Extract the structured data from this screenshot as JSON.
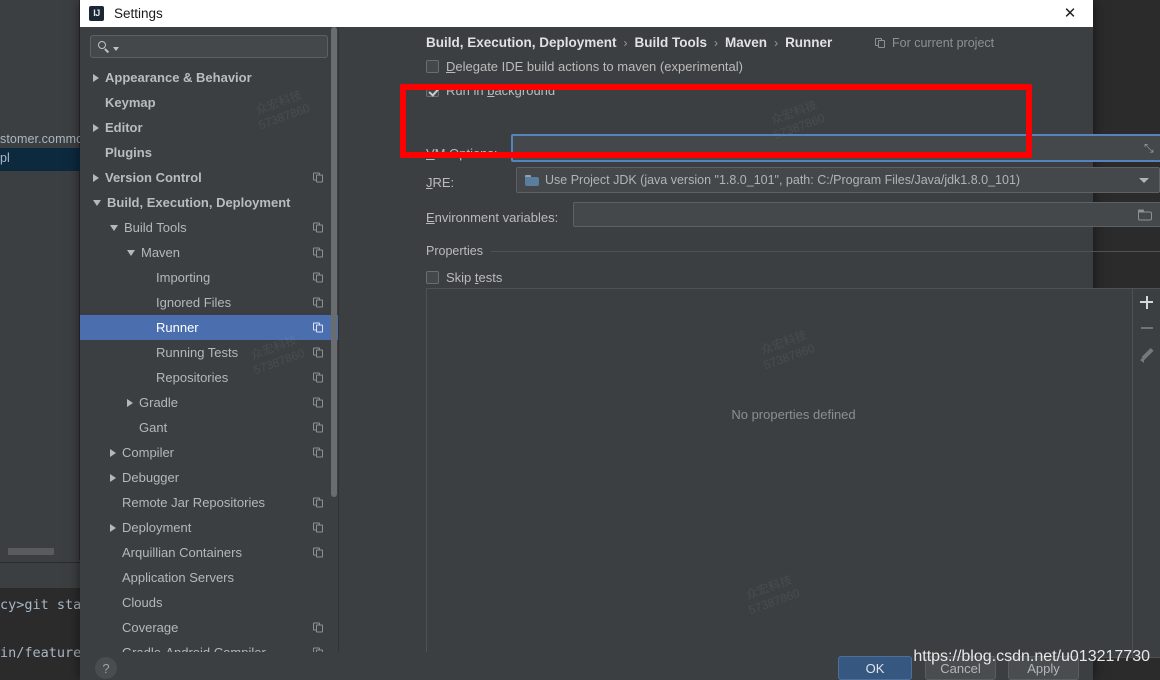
{
  "window": {
    "title": "Settings",
    "app_icon_text": "IJ",
    "close_icon": "close-icon",
    "close_glyph": "✕"
  },
  "sidebar": {
    "search": {
      "value": "",
      "placeholder": ""
    },
    "items": [
      {
        "label": "Appearance & Behavior",
        "indent": 0,
        "arrow": "right",
        "bold": true,
        "badge": false,
        "selected": false
      },
      {
        "label": "Keymap",
        "indent": 0,
        "arrow": "none",
        "bold": true,
        "badge": false,
        "selected": false
      },
      {
        "label": "Editor",
        "indent": 0,
        "arrow": "right",
        "bold": true,
        "badge": false,
        "selected": false
      },
      {
        "label": "Plugins",
        "indent": 0,
        "arrow": "none",
        "bold": true,
        "badge": false,
        "selected": false
      },
      {
        "label": "Version Control",
        "indent": 0,
        "arrow": "right",
        "bold": true,
        "badge": true,
        "selected": false
      },
      {
        "label": "Build, Execution, Deployment",
        "indent": 0,
        "arrow": "down",
        "bold": true,
        "badge": false,
        "selected": false
      },
      {
        "label": "Build Tools",
        "indent": 1,
        "arrow": "down",
        "bold": false,
        "badge": true,
        "selected": false
      },
      {
        "label": "Maven",
        "indent": 2,
        "arrow": "down",
        "bold": false,
        "badge": true,
        "selected": false
      },
      {
        "label": "Importing",
        "indent": 3,
        "arrow": "none",
        "bold": false,
        "badge": true,
        "selected": false
      },
      {
        "label": "Ignored Files",
        "indent": 3,
        "arrow": "none",
        "bold": false,
        "badge": true,
        "selected": false
      },
      {
        "label": "Runner",
        "indent": 3,
        "arrow": "none",
        "bold": false,
        "badge": true,
        "selected": true
      },
      {
        "label": "Running Tests",
        "indent": 3,
        "arrow": "none",
        "bold": false,
        "badge": true,
        "selected": false
      },
      {
        "label": "Repositories",
        "indent": 3,
        "arrow": "none",
        "bold": false,
        "badge": true,
        "selected": false
      },
      {
        "label": "Gradle",
        "indent": 2,
        "arrow": "right",
        "bold": false,
        "badge": true,
        "selected": false
      },
      {
        "label": "Gant",
        "indent": 2,
        "arrow": "none",
        "bold": false,
        "badge": true,
        "selected": false
      },
      {
        "label": "Compiler",
        "indent": 1,
        "arrow": "right",
        "bold": false,
        "badge": true,
        "selected": false
      },
      {
        "label": "Debugger",
        "indent": 1,
        "arrow": "right",
        "bold": false,
        "badge": false,
        "selected": false
      },
      {
        "label": "Remote Jar Repositories",
        "indent": 1,
        "arrow": "none",
        "bold": false,
        "badge": true,
        "selected": false
      },
      {
        "label": "Deployment",
        "indent": 1,
        "arrow": "right",
        "bold": false,
        "badge": true,
        "selected": false
      },
      {
        "label": "Arquillian Containers",
        "indent": 1,
        "arrow": "none",
        "bold": false,
        "badge": true,
        "selected": false
      },
      {
        "label": "Application Servers",
        "indent": 1,
        "arrow": "none",
        "bold": false,
        "badge": false,
        "selected": false
      },
      {
        "label": "Clouds",
        "indent": 1,
        "arrow": "none",
        "bold": false,
        "badge": false,
        "selected": false
      },
      {
        "label": "Coverage",
        "indent": 1,
        "arrow": "none",
        "bold": false,
        "badge": true,
        "selected": false
      },
      {
        "label": "Gradle-Android Compiler",
        "indent": 1,
        "arrow": "none",
        "bold": false,
        "badge": true,
        "selected": false
      }
    ]
  },
  "content": {
    "breadcrumb": [
      "Build, Execution, Deployment",
      "Build Tools",
      "Maven",
      "Runner"
    ],
    "breadcrumb_separator": "›",
    "for_current_project": "For current project",
    "delegate_checkbox": {
      "label": "Delegate IDE build actions to maven (experimental)",
      "mnemonic": "D",
      "checked": false
    },
    "run_background_checkbox": {
      "label": "Run in background",
      "mnemonic": "b",
      "checked": true
    },
    "vm_options": {
      "label": "VM Options:",
      "mnemonic": "V",
      "value": "",
      "expand_icon": "expand-icon",
      "expand_glyph": "⤡"
    },
    "jre": {
      "label": "JRE:",
      "mnemonic": "J",
      "value": "Use Project JDK (java version \"1.8.0_101\", path: C:/Program Files/Java/jdk1.8.0_101)"
    },
    "env_vars": {
      "label": "Environment variables:",
      "mnemonic": "E",
      "value": "",
      "browse_icon": "folder-icon"
    },
    "properties_group_label": "Properties",
    "skip_tests_checkbox": {
      "label": "Skip tests",
      "mnemonic": "t",
      "checked": false
    },
    "properties_empty_text": "No properties defined",
    "prop_toolbar": [
      {
        "name": "add-property-button",
        "icon": "plus-icon"
      },
      {
        "name": "remove-property-button",
        "icon": "minus-icon"
      },
      {
        "name": "edit-property-button",
        "icon": "pencil-icon"
      }
    ]
  },
  "footer": {
    "help_label": "?",
    "ok_label": "OK",
    "cancel_label": "Cancel",
    "apply_label": "Apply"
  },
  "overlays": {
    "watermark_url": "https://blog.csdn.net/u013217730",
    "annotation_color": "#FE0000",
    "faint_watermarks": [
      "众宏科技",
      "57387860"
    ]
  },
  "background_ide": {
    "project_text": "stomer.commo",
    "selected_text": "pl",
    "terminal_line1": "cy>git sta",
    "terminal_line2": "in/feature"
  }
}
